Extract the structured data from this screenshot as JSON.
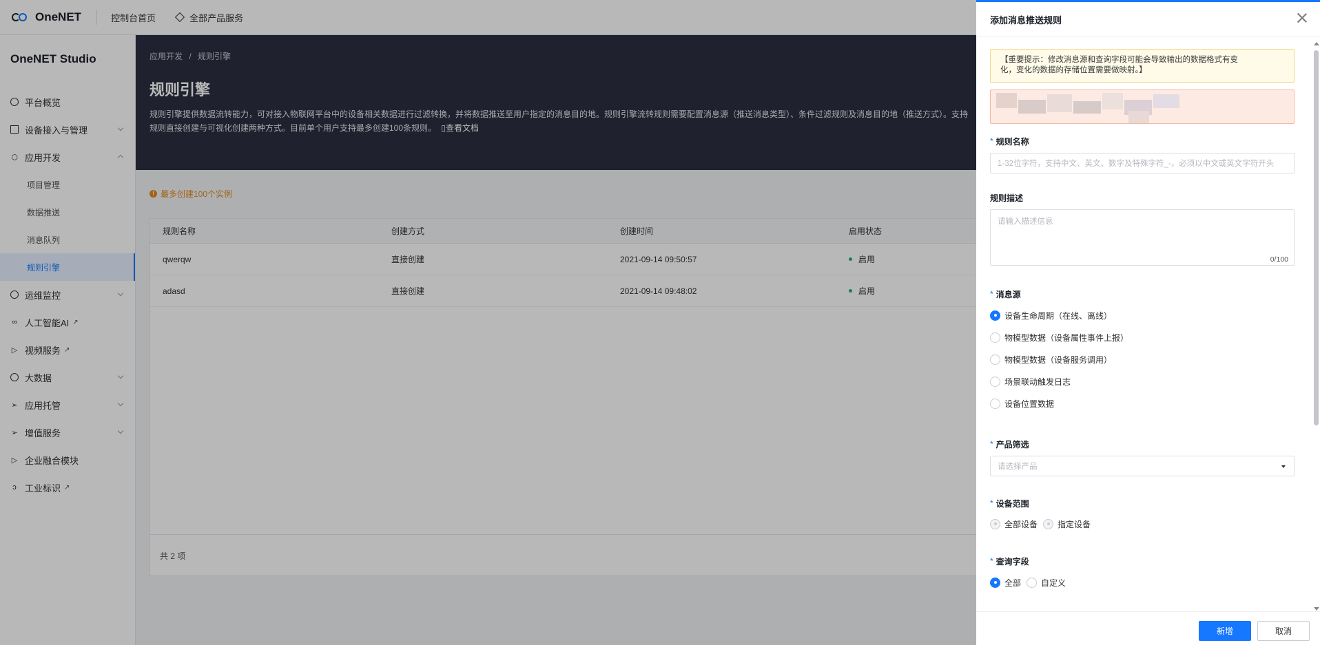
{
  "topbar": {
    "brand": "OneNET",
    "console_home": "控制台首页",
    "all_products": "全部产品服务"
  },
  "sidebar": {
    "studio_title": "OneNET Studio",
    "items": [
      {
        "label": "平台概览",
        "icon": "dashboard-icon"
      },
      {
        "label": "设备接入与管理",
        "icon": "device-icon"
      },
      {
        "label": "应用开发",
        "icon": "cube-icon"
      },
      {
        "label": "项目管理"
      },
      {
        "label": "数据推送"
      },
      {
        "label": "消息队列"
      },
      {
        "label": "规则引擎"
      },
      {
        "label": "运维监控",
        "icon": "monitor-icon"
      },
      {
        "label": "人工智能AI",
        "icon": "ai-icon"
      },
      {
        "label": "视频服务",
        "icon": "video-icon"
      },
      {
        "label": "大数据",
        "icon": "bigdata-icon"
      },
      {
        "label": "应用托管",
        "icon": "send-icon"
      },
      {
        "label": "增值服务",
        "icon": "send-icon"
      },
      {
        "label": "企业融合模块",
        "icon": "play-icon"
      },
      {
        "label": "工业标识",
        "icon": "link-icon"
      }
    ]
  },
  "hero": {
    "crumb_parent": "应用开发",
    "crumb_sep": "/",
    "crumb_current": "规则引擎",
    "title": "规则引擎",
    "description": "规则引擎提供数据流转能力，可对接入物联网平台中的设备相关数据进行过滤转换，并将数据推送至用户指定的消息目的地。规则引擎流转规则需要配置消息源（推送消息类型）、条件过滤规则及消息目的地（推送方式）。支持规则直接创建与可视化创建两种方式。目前单个用户支持最多创建100条规则。",
    "doc_link": "查看文档"
  },
  "main": {
    "warning": "最多创建100个实例",
    "columns": [
      "规则名称",
      "创建方式",
      "创建时间",
      "启用状态"
    ],
    "rows": [
      {
        "name": "qwerqw",
        "method": "直接创建",
        "time": "2021-09-14 09:50:57",
        "status": "启用"
      },
      {
        "name": "adasd",
        "method": "直接创建",
        "time": "2021-09-14 09:48:02",
        "status": "启用"
      }
    ],
    "total": "共 2 项"
  },
  "drawer": {
    "title": "添加消息推送规则",
    "notice_line1": "【重要提示：修改消息源和查询字段可能会导致输出的数据格式有变",
    "notice_line2": "化，变化的数据的存储位置需要做映射。】",
    "rule_name_label": "规则名称",
    "rule_name_placeholder": "1-32位字符，支持中文、英文、数字及特殊字符_-，必须以中文或英文字符开头",
    "desc_label": "规则描述",
    "desc_placeholder": "请输入描述信息",
    "desc_count": "0/100",
    "source_label": "消息源",
    "sources": [
      "设备生命周期（在线、离线）",
      "物模型数据（设备属性事件上报）",
      "物模型数据（设备服务调用）",
      "场景联动触发日志",
      "设备位置数据"
    ],
    "source_selected": 0,
    "product_label": "产品筛选",
    "product_placeholder": "请选择产品",
    "range_label": "设备范围",
    "range_all": "全部设备",
    "range_specific": "指定设备",
    "query_label": "查询字段",
    "query_all": "全部",
    "query_custom": "自定义",
    "submit": "新增",
    "cancel": "取消"
  },
  "colors": {
    "accent": "#1677ff",
    "hero_bg": "#2b3040",
    "warning": "#e08a1e",
    "status_on": "#23b26d"
  }
}
